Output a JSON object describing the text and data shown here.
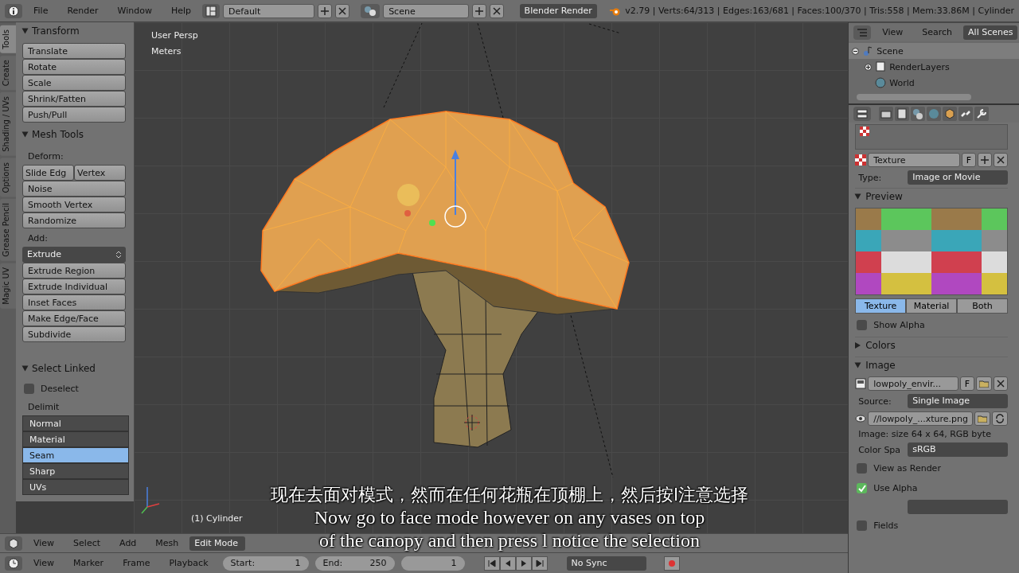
{
  "top_bar": {
    "menus": [
      "File",
      "Render",
      "Window",
      "Help"
    ],
    "layout": "Default",
    "scene": "Scene",
    "engine": "Blender Render",
    "stats": "v2.79 | Verts:64/313 | Edges:163/681 | Faces:100/370 | Tris:558 | Mem:33.86M | Cylinder"
  },
  "tool_tabs": [
    {
      "label": "Tools",
      "selected": true
    },
    {
      "label": "Create",
      "selected": false
    },
    {
      "label": "Shading / UVs",
      "selected": false
    },
    {
      "label": "Options",
      "selected": false
    },
    {
      "label": "Grease Pencil",
      "selected": false
    },
    {
      "label": "Magic UV",
      "selected": false
    }
  ],
  "tool_panels": [
    {
      "title": "Transform",
      "expanded": true,
      "items": [
        {
          "kind": "button",
          "label": "Translate"
        },
        {
          "kind": "button",
          "label": "Rotate"
        },
        {
          "kind": "button",
          "label": "Scale"
        },
        {
          "kind": "button",
          "label": "Shrink/Fatten"
        },
        {
          "kind": "button",
          "label": "Push/Pull"
        }
      ]
    },
    {
      "title": "Mesh Tools",
      "expanded": true,
      "items": [
        {
          "kind": "label",
          "label": "Deform:"
        },
        {
          "kind": "pair",
          "labels": [
            "Slide Edg",
            "Vertex"
          ]
        },
        {
          "kind": "button",
          "label": "Noise"
        },
        {
          "kind": "button",
          "label": "Smooth Vertex"
        },
        {
          "kind": "button",
          "label": "Randomize"
        },
        {
          "kind": "label",
          "label": "Add:"
        },
        {
          "kind": "dropdown",
          "label": "Extrude"
        },
        {
          "kind": "button",
          "label": "Extrude Region"
        },
        {
          "kind": "button",
          "label": "Extrude Individual"
        },
        {
          "kind": "button",
          "label": "Inset Faces"
        },
        {
          "kind": "button",
          "label": "Make Edge/Face"
        },
        {
          "kind": "button",
          "label": "Subdivide"
        }
      ]
    }
  ],
  "operator_panel": {
    "title": "Select Linked",
    "expanded": true,
    "deselect": {
      "label": "Deselect",
      "checked": false
    },
    "delimit_label": "Delimit",
    "delimit": [
      {
        "label": "Normal",
        "selected": false
      },
      {
        "label": "Material",
        "selected": false
      },
      {
        "label": "Seam",
        "selected": true
      },
      {
        "label": "Sharp",
        "selected": false
      },
      {
        "label": "UVs",
        "selected": false
      }
    ]
  },
  "viewport": {
    "view": "User Persp",
    "units": "Meters",
    "object": "(1) Cylinder"
  },
  "subtitles": [
    "现在去面对模式，然而在任何花瓶在顶棚上，然后按l注意选择",
    "Now go to face mode however on any vases on top",
    "of the canopy and then press l notice the selection"
  ],
  "view3d_header": {
    "menus": [
      "View",
      "Select",
      "Add",
      "Mesh"
    ],
    "mode": "Edit Mode"
  },
  "timeline": {
    "menus": [
      "View",
      "Marker",
      "Frame",
      "Playback"
    ],
    "start_label": "Start:",
    "start": "1",
    "end_label": "End:",
    "end": "250",
    "current": "1",
    "sync": "No Sync"
  },
  "outliner": {
    "menus": [
      "View",
      "Search"
    ],
    "filter": "All Scenes",
    "tree": [
      {
        "kind": "scene",
        "label": "Scene",
        "selected": true,
        "expanded": true,
        "children": [
          {
            "kind": "render_layers",
            "label": "RenderLayers",
            "selected": false,
            "expanded": false
          },
          {
            "kind": "world",
            "label": "World",
            "selected": false
          }
        ]
      }
    ]
  },
  "properties": {
    "texture_name": "Texture",
    "texture_flag": "F",
    "type_label": "Type:",
    "type": "Image or Movie",
    "preview": {
      "title": "Preview",
      "expanded": true,
      "tabs": [
        {
          "label": "Texture",
          "selected": true
        },
        {
          "label": "Material",
          "selected": false
        },
        {
          "label": "Both",
          "selected": false
        }
      ],
      "show_alpha": {
        "label": "Show Alpha",
        "checked": false
      }
    },
    "colors": {
      "title": "Colors",
      "expanded": false
    },
    "image": {
      "title": "Image",
      "expanded": true,
      "name": "lowpoly_envir...",
      "flag": "F",
      "source_label": "Source:",
      "source": "Single Image",
      "filepath": "//lowpoly_...xture.png",
      "info": "Image: size 64 x 64, RGB byte",
      "color_space_label": "Color Spa",
      "color_space": "sRGB",
      "view_as_render": {
        "label": "View as Render",
        "checked": false
      },
      "use_alpha": {
        "label": "Use Alpha",
        "checked": true
      },
      "fields": {
        "label": "Fields",
        "checked": false
      }
    }
  }
}
